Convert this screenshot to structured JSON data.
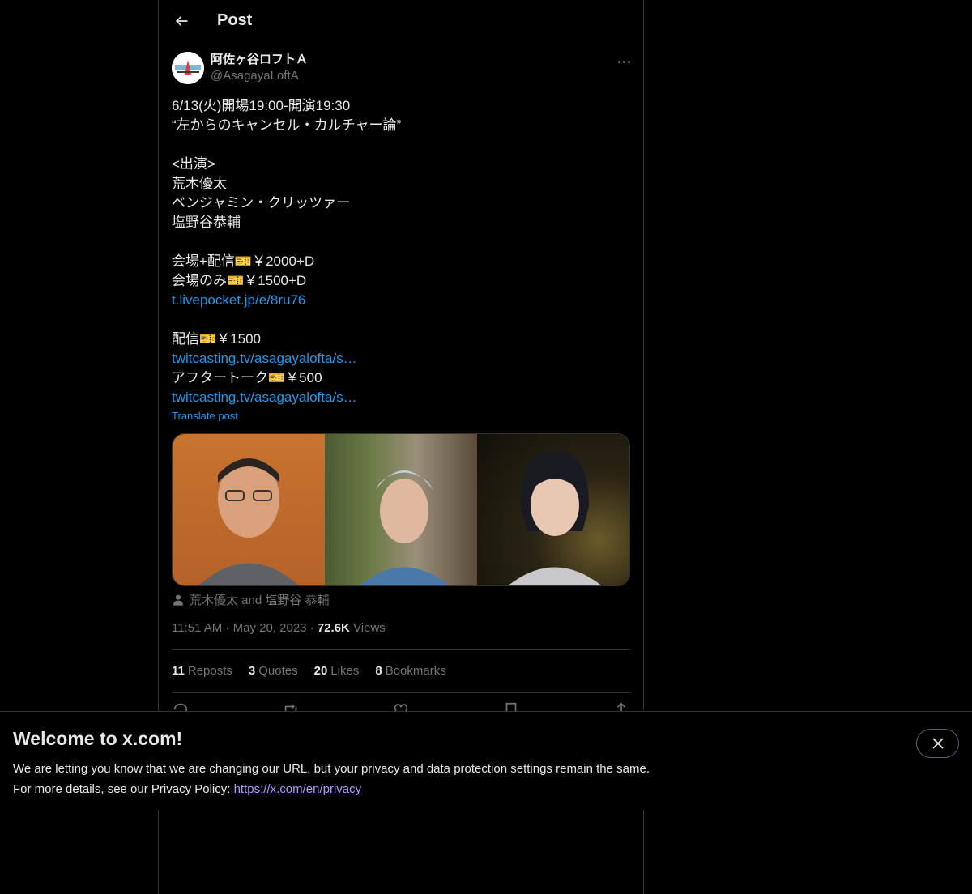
{
  "header": {
    "title": "Post"
  },
  "author": {
    "display_name": "阿佐ヶ谷ロフトＡ",
    "handle": "@AsagayaLoftA"
  },
  "post": {
    "lines": [
      {
        "text": "6/13(火)開場19:00-開演19:30",
        "type": "text"
      },
      {
        "text": "“左からのキャンセル・カルチャー論”",
        "type": "text"
      },
      {
        "text": "",
        "type": "text"
      },
      {
        "text": "<出演>",
        "type": "text"
      },
      {
        "text": "荒木優太",
        "type": "text"
      },
      {
        "text": "ベンジャミン・クリッツァー",
        "type": "text"
      },
      {
        "text": "塩野谷恭輔",
        "type": "text"
      },
      {
        "text": "",
        "type": "text"
      },
      {
        "text": "会場+配信🎫￥2000+D",
        "type": "text"
      },
      {
        "text": "会場のみ🎫￥1500+D",
        "type": "text"
      },
      {
        "text": "t.livepocket.jp/e/8ru76",
        "type": "link"
      },
      {
        "text": "",
        "type": "text"
      },
      {
        "text": "配信🎫￥1500",
        "type": "text"
      },
      {
        "text": "twitcasting.tv/asagayalofta/s…",
        "type": "link"
      },
      {
        "text": "アフタートーク🎫￥500",
        "type": "text"
      },
      {
        "text": "twitcasting.tv/asagayalofta/s…",
        "type": "link"
      }
    ],
    "translate_label": "Translate post",
    "tagged_people": "荒木優太 and 塩野谷 恭輔",
    "time": "11:51 AM",
    "date": "May 20, 2023",
    "views_count": "72.6K",
    "views_label": "Views"
  },
  "stats": [
    {
      "count": "11",
      "label": "Reposts"
    },
    {
      "count": "3",
      "label": "Quotes"
    },
    {
      "count": "20",
      "label": "Likes"
    },
    {
      "count": "8",
      "label": "Bookmarks"
    }
  ],
  "banner": {
    "title": "Welcome to x.com!",
    "line1": "We are letting you know that we are changing our URL, but your privacy and data protection settings remain the same.",
    "line2_prefix": "For more details, see our Privacy Policy: ",
    "link": "https://x.com/en/privacy"
  },
  "colors": {
    "accent": "#1d9bf0",
    "muted": "#71767b",
    "text": "#e7e9ea",
    "divider": "#2f3336"
  }
}
